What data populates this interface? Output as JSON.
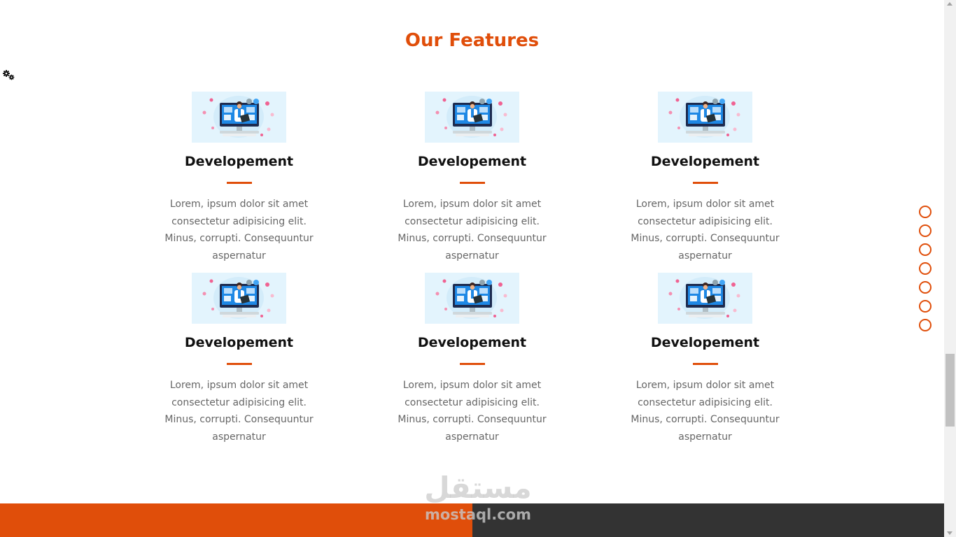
{
  "section": {
    "title": "Our Features"
  },
  "settings": {
    "icon": "gears-icon"
  },
  "features": [
    {
      "title": "Developement",
      "description": "Lorem, ipsum dolor sit amet consectetur adipisicing elit. Minus, corrupti. Consequuntur aspernatur",
      "image": "developer-illustration"
    },
    {
      "title": "Developement",
      "description": "Lorem, ipsum dolor sit amet consectetur adipisicing elit. Minus, corrupti. Consequuntur aspernatur",
      "image": "developer-illustration"
    },
    {
      "title": "Developement",
      "description": "Lorem, ipsum dolor sit amet consectetur adipisicing elit. Minus, corrupti. Consequuntur aspernatur",
      "image": "developer-illustration"
    },
    {
      "title": "Developement",
      "description": "Lorem, ipsum dolor sit amet consectetur adipisicing elit. Minus, corrupti. Consequuntur aspernatur",
      "image": "developer-illustration"
    },
    {
      "title": "Developement",
      "description": "Lorem, ipsum dolor sit amet consectetur adipisicing elit. Minus, corrupti. Consequuntur aspernatur",
      "image": "developer-illustration"
    },
    {
      "title": "Developement",
      "description": "Lorem, ipsum dolor sit amet consectetur adipisicing elit. Minus, corrupti. Consequuntur aspernatur",
      "image": "developer-illustration"
    }
  ],
  "nav_dots_count": 7,
  "watermark": {
    "arabic": "مستقل",
    "latin": "mostaql.com"
  },
  "colors": {
    "accent": "#e04e0a",
    "footer_dark": "#333333",
    "text_muted": "#666666",
    "thumb_bg": "#e3f4fd"
  }
}
